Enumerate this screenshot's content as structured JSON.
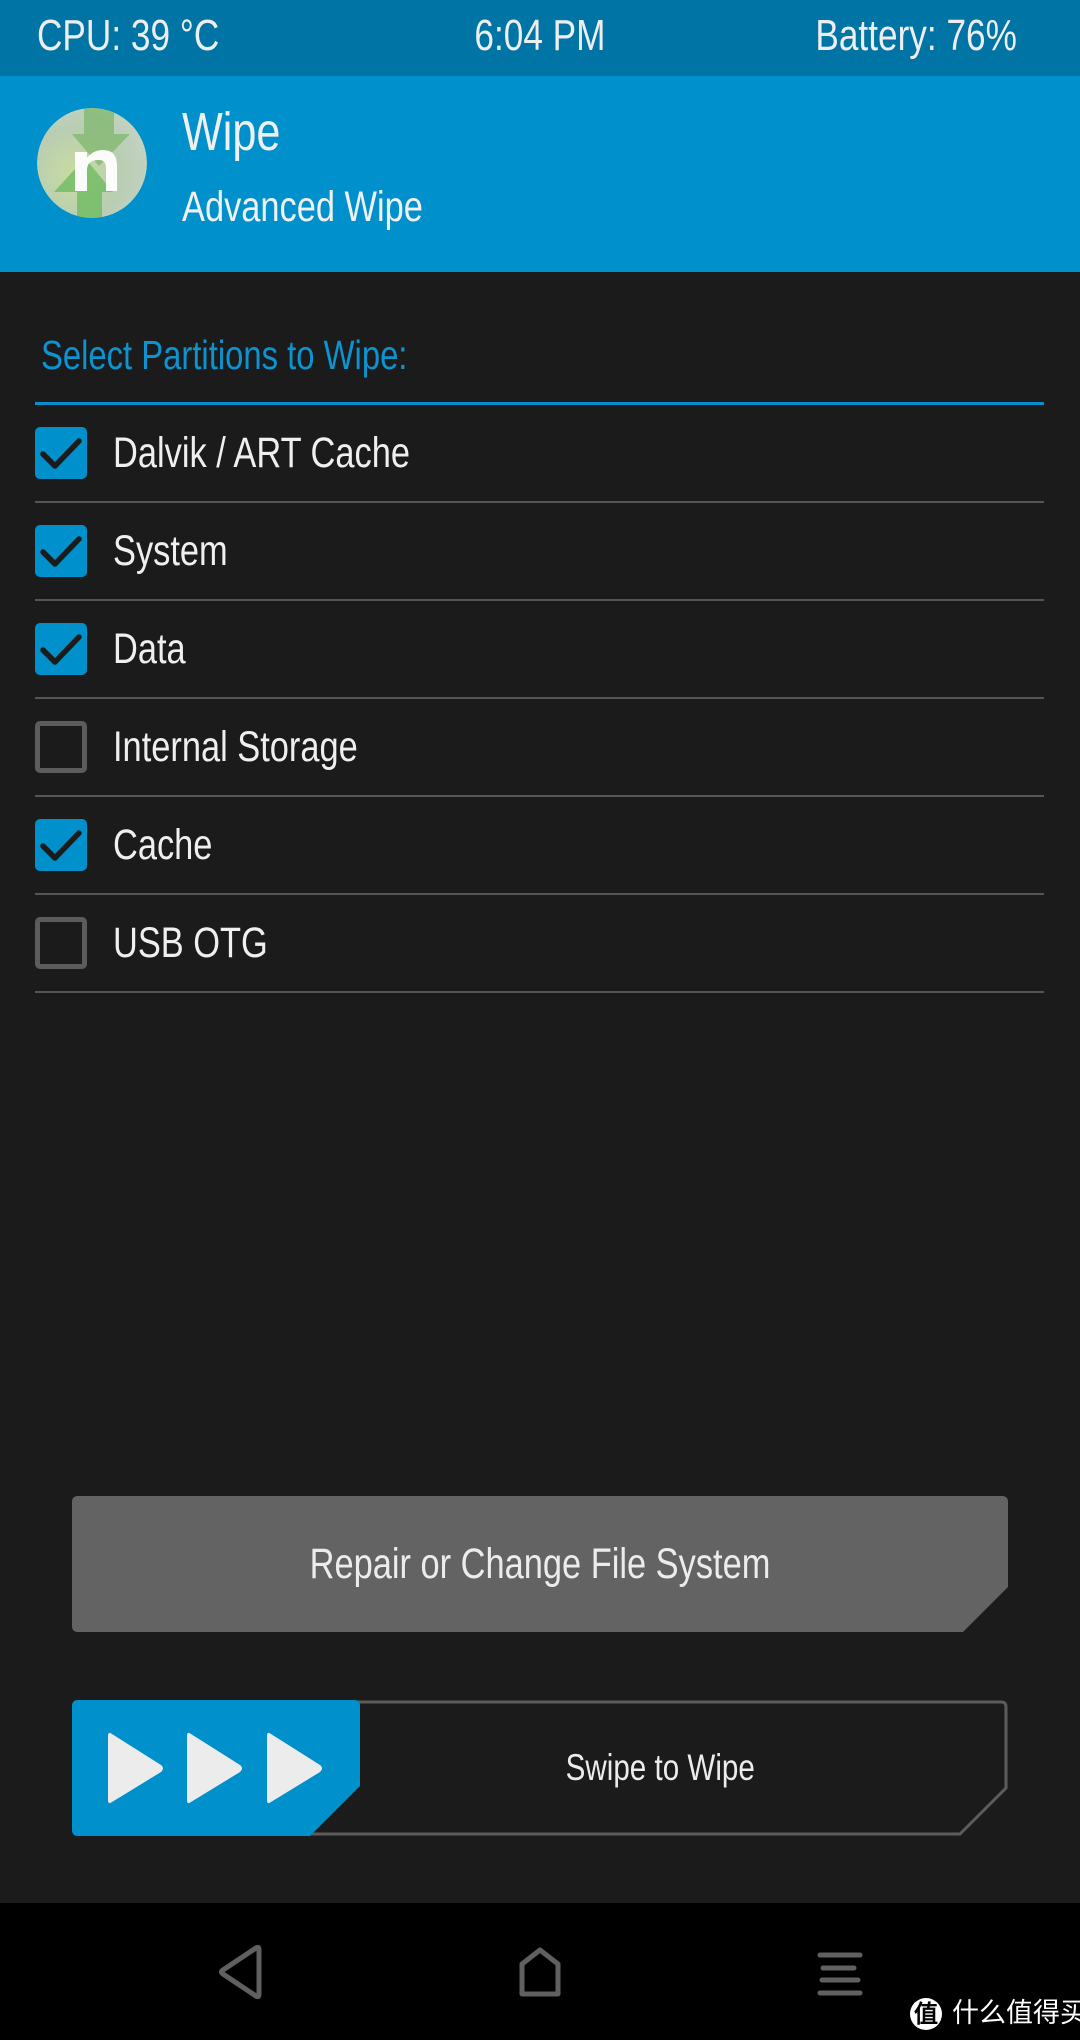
{
  "status_bar": {
    "cpu": "CPU: 39 °C",
    "time": "6:04 PM",
    "battery": "Battery: 76%"
  },
  "header": {
    "logo_icon": "twrp-logo",
    "logo_letter": "n",
    "title": "Wipe",
    "subtitle": "Advanced Wipe"
  },
  "section": {
    "label": "Select Partitions to Wipe:"
  },
  "partitions": [
    {
      "label": "Dalvik / ART Cache",
      "checked": true
    },
    {
      "label": "System",
      "checked": true
    },
    {
      "label": "Data",
      "checked": true
    },
    {
      "label": "Internal Storage",
      "checked": false
    },
    {
      "label": "Cache",
      "checked": true
    },
    {
      "label": "USB OTG",
      "checked": false
    }
  ],
  "buttons": {
    "repair": "Repair or Change File System",
    "swipe": "Swipe to Wipe",
    "swipe_icon": "triple-play-arrows"
  },
  "navbar": {
    "back_icon": "back-triangle",
    "home_icon": "home",
    "menu_icon": "menu-lines"
  },
  "watermark": {
    "badge": "值",
    "text": "什么值得买"
  },
  "colors": {
    "status_bar": "#0075a5",
    "accent": "#0090cc",
    "background": "#1b1b1b",
    "button_gray": "#636363",
    "separator": "#555555"
  }
}
